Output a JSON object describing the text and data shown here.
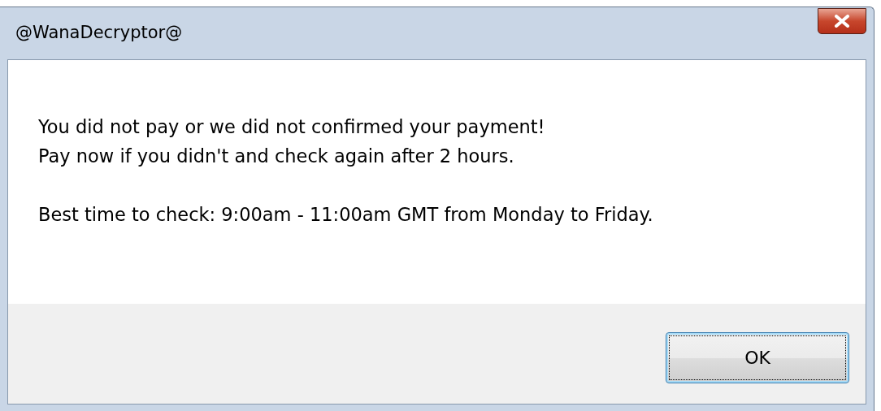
{
  "window": {
    "title": "@WanaDecryptor@"
  },
  "paragraphs": [
    [
      "You did not pay or we did not confirmed your payment!",
      "Pay now if you didn't and check again after 2 hours."
    ],
    [
      "Best time to check: 9:00am - 11:00am GMT from Monday to Friday."
    ]
  ],
  "buttons": [
    {
      "label": "OK",
      "default": true
    }
  ]
}
